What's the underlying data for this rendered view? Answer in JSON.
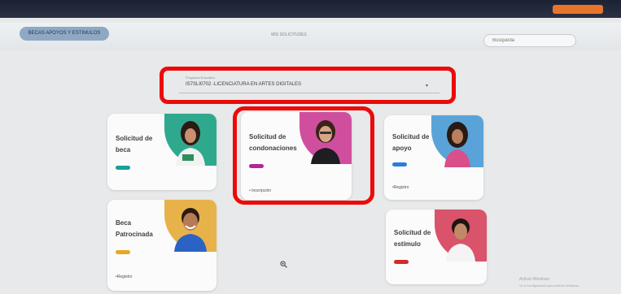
{
  "topbar": {
    "user_button": ""
  },
  "nav": {
    "tab_label": "BECAS APOYOS Y ESTIMULOS",
    "title": "MIS SOLICITUDES",
    "search_placeholder": "Búsqueda"
  },
  "program_select": {
    "label": "Programa Educativo",
    "value": "IS7SLI0702 -LICENCIATURA EN ARTES DIGITALES"
  },
  "cards": [
    {
      "title_1": "Solicitud de",
      "title_2": "beca",
      "link": "",
      "bar_color": "#1a9f9a",
      "art_color": "#2fa98e"
    },
    {
      "title_1": "Solicitud de",
      "title_2": "condonaciones",
      "link": "• Inscripción",
      "bar_color": "#b0269d",
      "art_color": "#cf4f9e"
    },
    {
      "title_1": "Solicitud de",
      "title_2": "apoyo",
      "link": "•Registro",
      "bar_color": "#2a7fd4",
      "art_color": "#5aa3d8"
    },
    {
      "title_1": "Beca",
      "title_2": "Patrocinada",
      "link": "•Registro",
      "bar_color": "#e6a820",
      "art_color": "#e8b24a"
    },
    {
      "title_1": "Solicitud de",
      "title_2": "estímulo",
      "link": "",
      "bar_color": "#d52a2a",
      "art_color": "#d9536a"
    }
  ],
  "watermark": {
    "line1": "Activar Windows",
    "line2": "Ve a Configuración para activar Windows."
  },
  "icons": {
    "zoom": "zoom-in-icon"
  }
}
